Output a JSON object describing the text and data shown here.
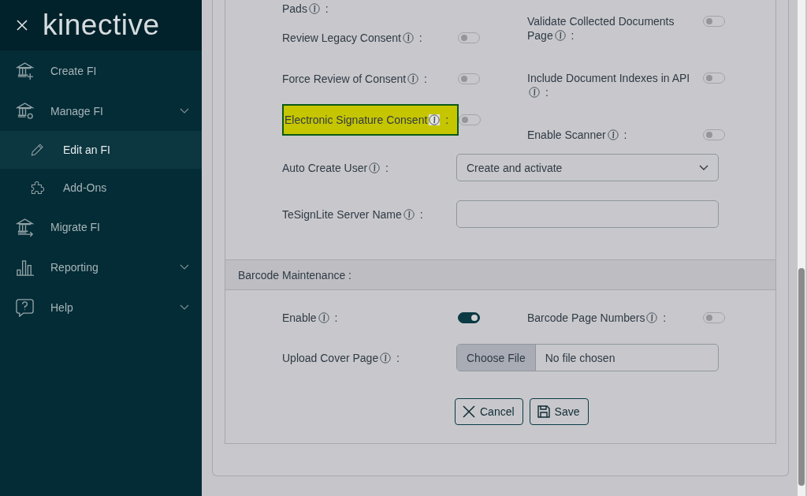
{
  "sidebar": {
    "logo": "kinective",
    "items": [
      {
        "label": "Create FI",
        "selected": false
      },
      {
        "label": "Manage FI",
        "selected": false,
        "kind": "menu",
        "children": [
          {
            "label": "Edit an FI",
            "selected": true
          },
          {
            "label": "Add-Ons",
            "selected": false
          }
        ]
      },
      {
        "label": "Migrate FI",
        "selected": false
      },
      {
        "label": "Reporting",
        "selected": false,
        "kind": "menu"
      },
      {
        "label": "Help",
        "selected": false,
        "kind": "menu"
      }
    ]
  },
  "settings": {
    "left_toggles": [
      {
        "label": "Pads",
        "suffix": ":"
      },
      {
        "label": "Review Legacy Consent",
        "suffix": ":",
        "on": false,
        "highlighted": false
      },
      {
        "label": "Force Review of Consent",
        "suffix": ":",
        "on": false,
        "highlighted": false
      },
      {
        "label": "Electronic Signature Consent",
        "suffix": ":",
        "on": false,
        "highlighted": true
      }
    ],
    "right_toggles": [
      {
        "label": "Validate Collected Documents Page",
        "suffix": ":",
        "on": false
      },
      {
        "label": "Include Document Indexes in API",
        "suffix": ":",
        "on": false
      },
      {
        "label": "Enable Scanner",
        "suffix": ":",
        "on": false
      }
    ],
    "fields": [
      {
        "kind": "select",
        "label": "Auto Create User",
        "suffix": ":",
        "value": "Create and activate"
      },
      {
        "kind": "text",
        "label": "TeSignLite Server Name",
        "suffix": ":"
      }
    ]
  },
  "barcode": {
    "title": "Barcode Maintenance :",
    "toggles": [
      {
        "label": "Enable",
        "suffix": ":",
        "on": true
      },
      {
        "label": "Barcode Page Numbers",
        "suffix": ":",
        "on": false
      }
    ],
    "upload": {
      "label": "Upload Cover Page",
      "suffix": ":",
      "button": "Choose File",
      "status": "No file chosen"
    }
  },
  "buttons": [
    {
      "kind": "cancel",
      "label": "Cancel"
    },
    {
      "kind": "save",
      "label": "Save"
    }
  ]
}
